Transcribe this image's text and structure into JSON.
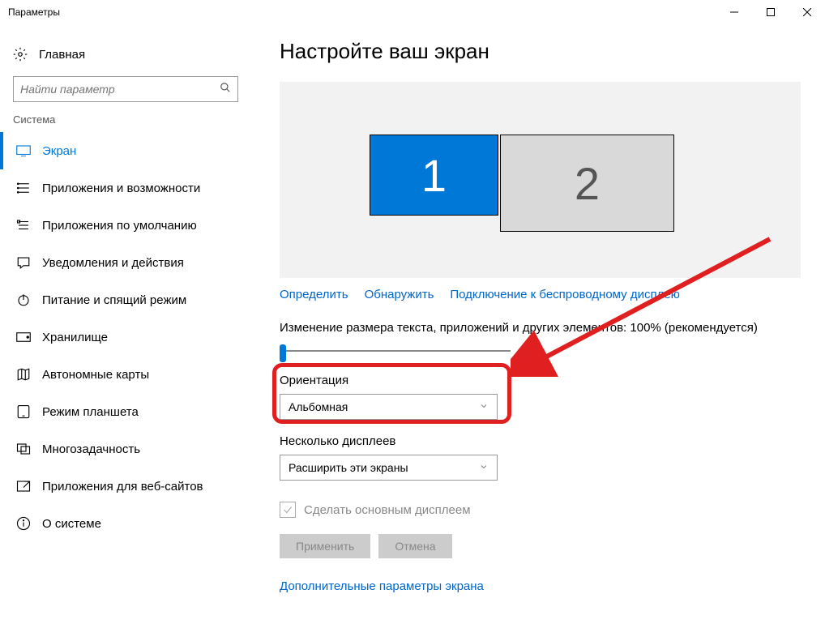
{
  "titlebar": {
    "title": "Параметры"
  },
  "sidebar": {
    "home": "Главная",
    "search_placeholder": "Найти параметр",
    "category": "Система",
    "items": [
      {
        "label": "Экран",
        "icon": "display-icon",
        "selected": true
      },
      {
        "label": "Приложения и возможности",
        "icon": "apps-icon"
      },
      {
        "label": "Приложения по умолчанию",
        "icon": "default-apps-icon"
      },
      {
        "label": "Уведомления и действия",
        "icon": "notifications-icon"
      },
      {
        "label": "Питание и спящий режим",
        "icon": "power-icon"
      },
      {
        "label": "Хранилище",
        "icon": "storage-icon"
      },
      {
        "label": "Автономные карты",
        "icon": "maps-icon"
      },
      {
        "label": "Режим планшета",
        "icon": "tablet-icon"
      },
      {
        "label": "Многозадачность",
        "icon": "multitask-icon"
      },
      {
        "label": "Приложения для веб-сайтов",
        "icon": "web-apps-icon"
      },
      {
        "label": "О системе",
        "icon": "about-icon"
      }
    ]
  },
  "main": {
    "title": "Настройте ваш экран",
    "monitor1": "1",
    "monitor2": "2",
    "links": {
      "identify": "Определить",
      "detect": "Обнаружить",
      "wireless": "Подключение к беспроводному дисплею"
    },
    "scale_label": "Изменение размера текста, приложений и других элементов: 100% (рекомендуется)",
    "orientation_label": "Ориентация",
    "orientation_value": "Альбомная",
    "multi_label": "Несколько дисплеев",
    "multi_value": "Расширить эти экраны",
    "make_primary": "Сделать основным дисплеем",
    "apply": "Применить",
    "cancel": "Отмена",
    "advanced": "Дополнительные параметры экрана"
  }
}
